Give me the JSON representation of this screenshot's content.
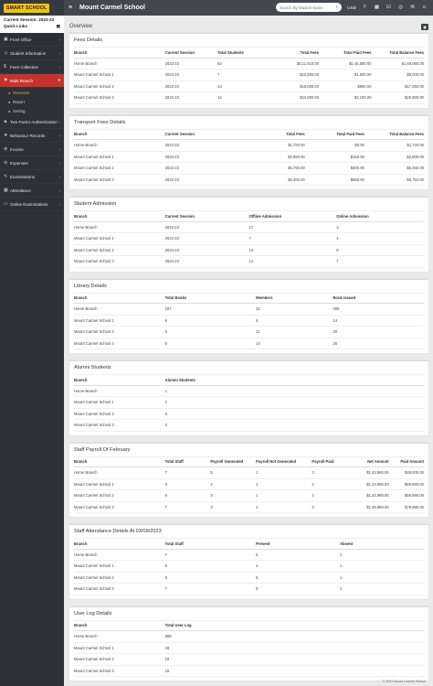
{
  "topbar": {
    "logo": "SMART SCHOOL",
    "school": "Mount Carmel School",
    "search_placeholder": "Search By Student Name",
    "currency": "USD"
  },
  "sidebar": {
    "session": "Current Session: 2022-23",
    "quick_links": "Quick Links",
    "items": [
      {
        "label": "Front Office",
        "icon": "building-icon",
        "glyph": "▣"
      },
      {
        "label": "Student Information",
        "icon": "user-icon",
        "glyph": "☺"
      },
      {
        "label": "Fees Collection",
        "icon": "money-icon",
        "glyph": "$"
      },
      {
        "label": "Multi Branch",
        "icon": "branch-icon",
        "glyph": "⚑",
        "active": true
      },
      {
        "label": "Two Factor Authentication",
        "icon": "shield-icon",
        "glyph": "◈"
      },
      {
        "label": "Behaviour Records",
        "icon": "star-icon",
        "glyph": "★"
      },
      {
        "label": "Income",
        "icon": "income-icon",
        "glyph": "⊕"
      },
      {
        "label": "Expenses",
        "icon": "expense-icon",
        "glyph": "⊖"
      },
      {
        "label": "Examinations",
        "icon": "exam-icon",
        "glyph": "✎"
      },
      {
        "label": "Attendance",
        "icon": "calendar-icon",
        "glyph": "▦"
      },
      {
        "label": "Online Examinations",
        "icon": "laptop-icon",
        "glyph": "▭"
      }
    ],
    "subitems": [
      "Overview",
      "Report",
      "Setting"
    ]
  },
  "page": {
    "title": "Overview"
  },
  "fees": {
    "title": "Fees Details",
    "headers": [
      "Branch",
      "Current Session",
      "Total Students",
      "Total Fees",
      "Total Paid Fees",
      "Total Balance Fees"
    ],
    "rows": [
      [
        "Home Branch",
        "2022-23",
        "53",
        "$3,11,610.00",
        "$1,45,560.00",
        "$1,66,050.00"
      ],
      [
        "Mount Carmel School 1",
        "2022-23",
        "7",
        "$10,500.00",
        "$1,500.00",
        "$9,000.00"
      ],
      [
        "Mount Carmel School 2",
        "2022-23",
        "13",
        "$18,000.00",
        "$950.00",
        "$17,050.00"
      ],
      [
        "Mount Carmel School 3",
        "2022-23",
        "14",
        "$24,000.00",
        "$3,100.00",
        "$20,900.00"
      ]
    ]
  },
  "transport": {
    "title": "Transport Fees Details",
    "headers": [
      "Branch",
      "Current Session",
      "Total Fees",
      "Total Paid Fees",
      "Total Balance Fees"
    ],
    "rows": [
      [
        "Home Branch",
        "2022-23",
        "$1,720.00",
        "$0.00",
        "$1,720.00"
      ],
      [
        "Mount Carmel School 1",
        "2022-23",
        "$2,950.00",
        "$150.00",
        "$2,800.00"
      ],
      [
        "Mount Carmel School 2",
        "2022-23",
        "$5,750.00",
        "$300.00",
        "$5,450.00"
      ],
      [
        "Mount Carmel School 3",
        "2022-23",
        "$6,300.00",
        "$550.00",
        "$5,750.00"
      ]
    ]
  },
  "admission": {
    "title": "Student Admission",
    "headers": [
      "Branch",
      "Current Session",
      "Offline Admission",
      "Online Admission"
    ],
    "rows": [
      [
        "Home Branch",
        "2022-23",
        "17",
        "3"
      ],
      [
        "Mount Carmel School 1",
        "2022-23",
        "7",
        "4"
      ],
      [
        "Mount Carmel School 2",
        "2022-23",
        "13",
        "6"
      ],
      [
        "Mount Carmel School 3",
        "2022-23",
        "14",
        "7"
      ]
    ]
  },
  "library": {
    "title": "Library Details",
    "headers": [
      "Branch",
      "Total Books",
      "Members",
      "Book Issued"
    ],
    "rows": [
      [
        "Home Branch",
        "197",
        "31",
        "305"
      ],
      [
        "Mount Carmel School 1",
        "6",
        "8",
        "14"
      ],
      [
        "Mount Carmel School 2",
        "5",
        "11",
        "20"
      ],
      [
        "Mount Carmel School 3",
        "5",
        "14",
        "26"
      ]
    ]
  },
  "alumni": {
    "title": "Alumni Students",
    "headers": [
      "Branch",
      "Alumni Students"
    ],
    "rows": [
      [
        "Home Branch",
        "1"
      ],
      [
        "Mount Carmel School 1",
        "2"
      ],
      [
        "Mount Carmel School 2",
        "5"
      ],
      [
        "Mount Carmel School 3",
        "2"
      ]
    ]
  },
  "payroll": {
    "title": "Staff Payroll Of February",
    "headers": [
      "Branch",
      "Total Staff",
      "Payroll Generated",
      "Payroll Not Generated",
      "Payroll Paid",
      "Net Amount",
      "Paid Amount"
    ],
    "rows": [
      [
        "Home Branch",
        "7",
        "5",
        "1",
        "3",
        "$1,42,990.00",
        "$48,000.00"
      ],
      [
        "Mount Carmel School 1",
        "5",
        "2",
        "1",
        "2",
        "$1,14,990.00",
        "$59,990.00"
      ],
      [
        "Mount Carmel School 2",
        "6",
        "3",
        "1",
        "3",
        "$1,34,990.00",
        "$59,990.00"
      ],
      [
        "Mount Carmel School 3",
        "7",
        "3",
        "1",
        "3",
        "$1,39,990.00",
        "$79,990.00"
      ]
    ]
  },
  "staff_attendance": {
    "title": "Staff Attendance Details At 03/09/2023",
    "headers": [
      "Branch",
      "Total Staff",
      "Present",
      "Absent"
    ],
    "rows": [
      [
        "Home Branch",
        "7",
        "5",
        "2"
      ],
      [
        "Mount Carmel School 1",
        "5",
        "4",
        "1"
      ],
      [
        "Mount Carmel School 2",
        "6",
        "5",
        "1"
      ],
      [
        "Mount Carmel School 3",
        "7",
        "5",
        "2"
      ]
    ]
  },
  "userlog": {
    "title": "User Log Details",
    "headers": [
      "Branch",
      "Total User Log"
    ],
    "rows": [
      [
        "Home Branch",
        "999"
      ],
      [
        "Mount Carmel School 1",
        "18"
      ],
      [
        "Mount Carmel School 2",
        "19"
      ],
      [
        "Mount Carmel School 3",
        "16"
      ]
    ]
  },
  "footer": "© 2023 Mount Carmel School"
}
